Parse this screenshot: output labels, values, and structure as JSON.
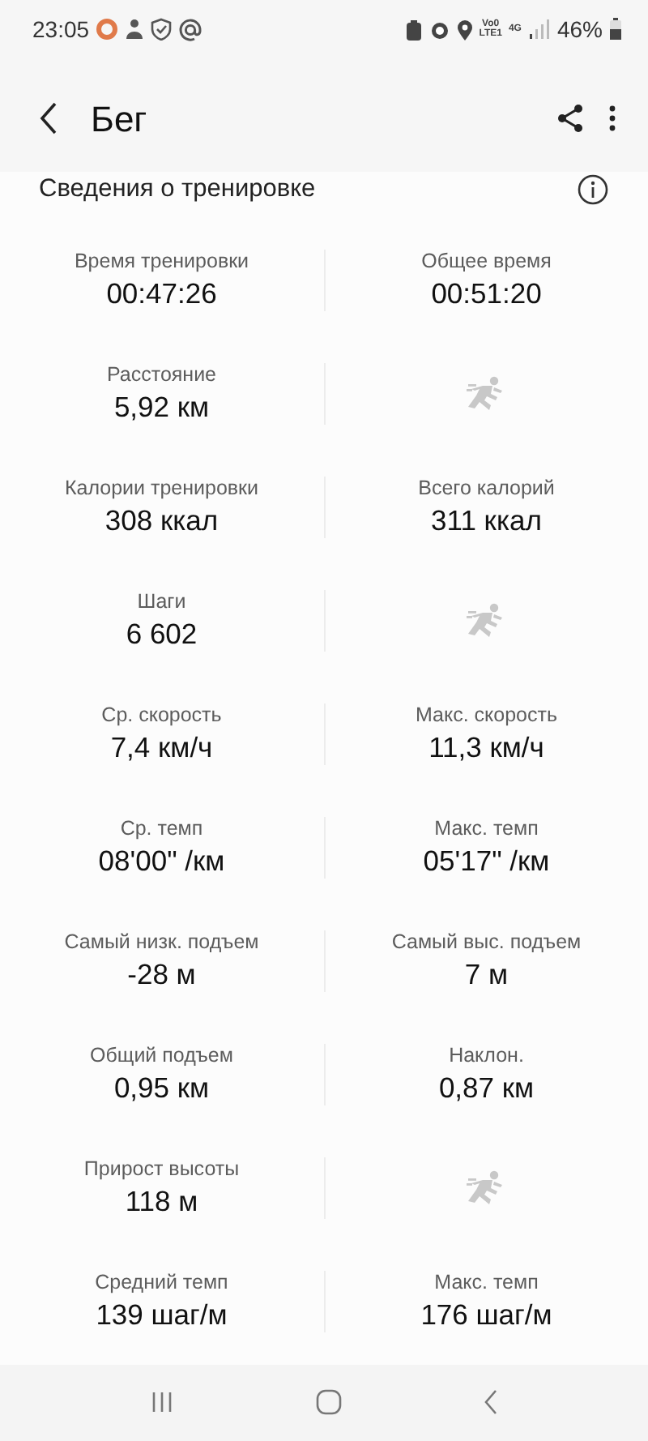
{
  "status_bar": {
    "time": "23:05",
    "network_top": "Vo0",
    "network_bottom": "LTE1",
    "network_type": "4G",
    "battery": "46%"
  },
  "header": {
    "title": "Бег"
  },
  "section": {
    "title": "Сведения о тренировке"
  },
  "rows": [
    [
      {
        "kind": "stat",
        "label": "Время тренировки",
        "value": "00:47:26"
      },
      {
        "kind": "stat",
        "label": "Общее время",
        "value": "00:51:20"
      }
    ],
    [
      {
        "kind": "stat",
        "label": "Расстояние",
        "value": "5,92 км"
      },
      {
        "kind": "placeholder"
      }
    ],
    [
      {
        "kind": "stat",
        "label": "Калории тренировки",
        "value": "308 ккал"
      },
      {
        "kind": "stat",
        "label": "Всего калорий",
        "value": "311 ккал"
      }
    ],
    [
      {
        "kind": "stat",
        "label": "Шаги",
        "value": "6 602"
      },
      {
        "kind": "placeholder"
      }
    ],
    [
      {
        "kind": "stat",
        "label": "Ср. скорость",
        "value": "7,4 км/ч"
      },
      {
        "kind": "stat",
        "label": "Макс. скорость",
        "value": "11,3 км/ч"
      }
    ],
    [
      {
        "kind": "stat",
        "label": "Ср. темп",
        "value": "08'00\" /км"
      },
      {
        "kind": "stat",
        "label": "Макс. темп",
        "value": "05'17\" /км"
      }
    ],
    [
      {
        "kind": "stat",
        "label": "Самый низк. подъем",
        "value": "-28 м"
      },
      {
        "kind": "stat",
        "label": "Самый выс. подъем",
        "value": "7 м"
      }
    ],
    [
      {
        "kind": "stat",
        "label": "Общий подъем",
        "value": "0,95 км"
      },
      {
        "kind": "stat",
        "label": "Наклон.",
        "value": "0,87 км"
      }
    ],
    [
      {
        "kind": "stat",
        "label": "Прирост высоты",
        "value": "118 м"
      },
      {
        "kind": "placeholder"
      }
    ],
    [
      {
        "kind": "stat",
        "label": "Средний темп",
        "value": "139 шаг/м"
      },
      {
        "kind": "stat",
        "label": "Макс. темп",
        "value": "176 шаг/м"
      }
    ]
  ]
}
